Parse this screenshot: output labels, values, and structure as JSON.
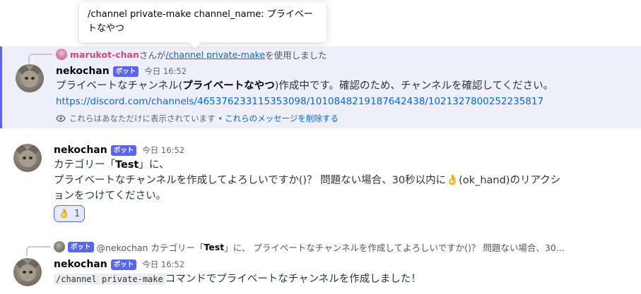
{
  "tooltip": {
    "text": "/channel private-make channel_name: プライベートなやつ"
  },
  "messages": {
    "m1": {
      "reply_user": "marukot-chan",
      "reply_mid": "さんが",
      "reply_command": "/channel private-make",
      "reply_suffix": "を使用しました",
      "username": "nekochan",
      "bot_tag": "ボット",
      "time": "今日 16:52",
      "text_pre": "プライベートなチャンネル(",
      "text_bold": "プライベートなやつ",
      "text_post": ")作成中です。確認のため、チャンネルを確認してください。",
      "link": "https://discord.com/channels/465376233115353098/1010848219187642438/1021327800252235817",
      "note": "これらはあなただけに表示されています •",
      "note_delete": "これらのメッセージを削除する"
    },
    "m2": {
      "username": "nekochan",
      "bot_tag": "ボット",
      "time": "今日 16:52",
      "line1_pre": "カテゴリー「",
      "line1_bold": "Test",
      "line1_post": "」に、",
      "line2": "プライベートなチャンネルを作成してよろしいですか()？ 問題ない場合、30秒以内に",
      "line2_emoji": "👌",
      "line2_post": "(ok_hand)のリアクシ",
      "line3": "ョンをつけてください。",
      "reaction_emoji": "👌",
      "reaction_count": "1"
    },
    "m3": {
      "reply_bot_tag": "ボット",
      "reply_text_pre": "@nekochan カテゴリー「",
      "reply_text_bold": "Test",
      "reply_text_post": "」に、 プライベートなチャンネルを作成してよろしいですか()？ 問題ない場合、30...",
      "username": "nekochan",
      "bot_tag": "ボット",
      "time": "今日 16:52",
      "code": "/channel private-make",
      "text": "コマンドでプライベートなチャンネルを作成しました！"
    }
  }
}
